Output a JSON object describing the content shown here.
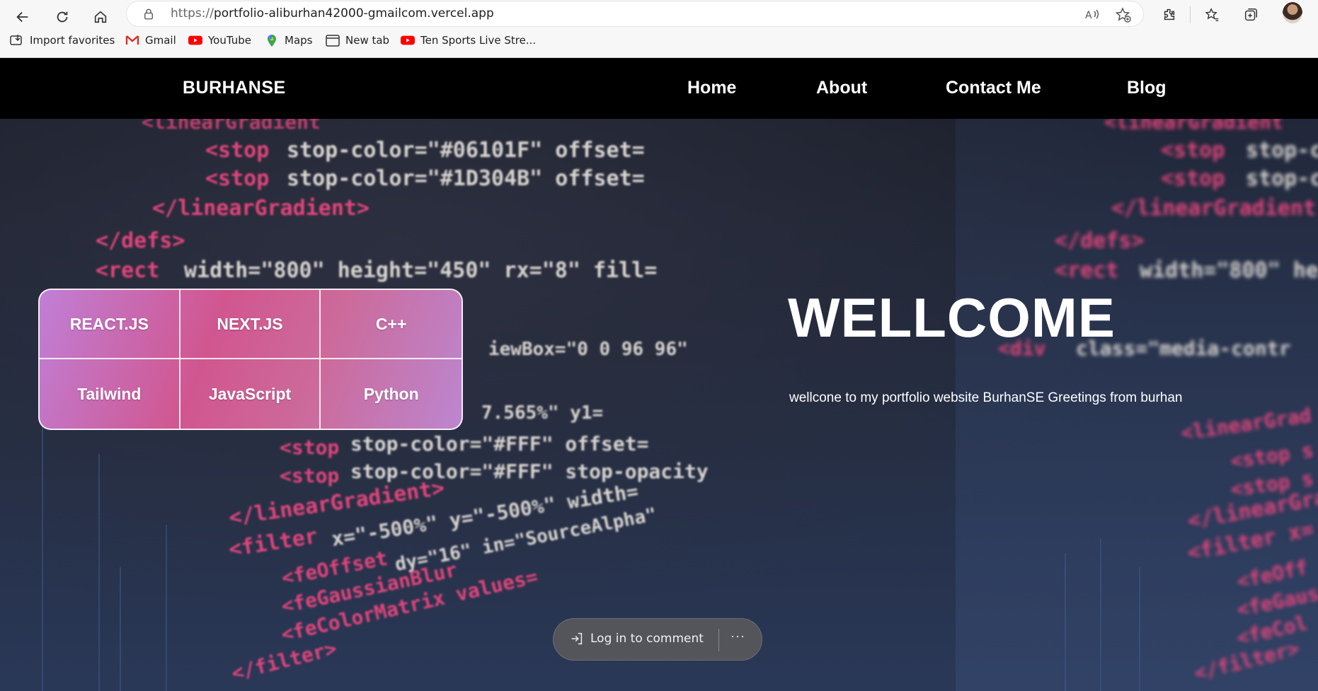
{
  "browser": {
    "url_protocol": "https://",
    "url_rest": "portfolio-aliburhan42000-gmailcom.vercel.app",
    "bookmarks": [
      {
        "label": "Import favorites",
        "icon": "import-icon"
      },
      {
        "label": "Gmail",
        "icon": "gmail-icon"
      },
      {
        "label": "YouTube",
        "icon": "youtube-icon"
      },
      {
        "label": "Maps",
        "icon": "maps-icon"
      },
      {
        "label": "New tab",
        "icon": "new-tab-icon"
      },
      {
        "label": "Ten Sports Live Stre...",
        "icon": "youtube-icon"
      }
    ]
  },
  "site": {
    "brand": "BURHANSE",
    "nav": [
      "Home",
      "About",
      "Contact Me",
      "Blog"
    ],
    "skills": [
      "REACT.JS",
      "NEXT.JS",
      "C++",
      "Tailwind",
      "JavaScript",
      "Python"
    ],
    "welcome_title": "WELLCOME",
    "welcome_text": "wellcone to my portfolio website BurhanSE Greetings from burhan"
  },
  "comment_bar": {
    "login_label": "Log in to comment",
    "more_label": "···"
  },
  "colors": {
    "nav_bg": "#000000",
    "skill_gradient_start": "#c07fd6",
    "skill_gradient_mid": "#d1568f",
    "code_pink": "#e0457a"
  }
}
